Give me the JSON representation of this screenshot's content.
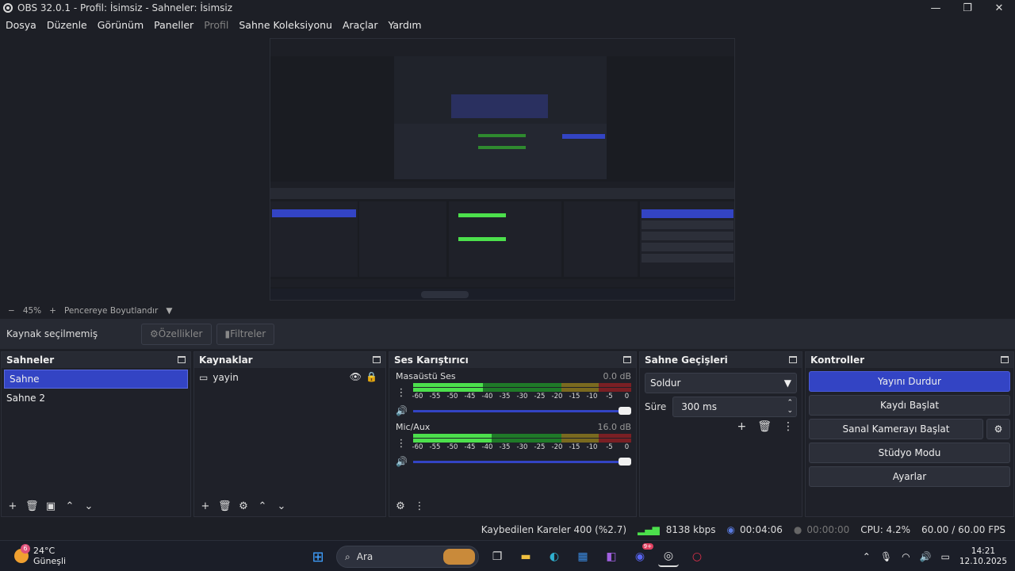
{
  "window": {
    "title": "OBS 32.0.1 - Profil: İsimsiz - Sahneler: İsimsiz"
  },
  "menu": [
    "Dosya",
    "Düzenle",
    "Görünüm",
    "Paneller",
    "Profil",
    "Sahne Koleksiyonu",
    "Araçlar",
    "Yardım"
  ],
  "zoom": {
    "minus": "−",
    "value": "45%",
    "plus": "+",
    "fit_label": "Pencereye Boyutlandır"
  },
  "toolbar": {
    "no_source": "Kaynak seçilmemiş",
    "properties": "Özellikler",
    "filters": "Filtreler"
  },
  "scenes": {
    "title": "Sahneler",
    "items": [
      "Sahne",
      "Sahne 2"
    ],
    "selected": 0
  },
  "sources": {
    "title": "Kaynaklar",
    "items": [
      "yayin"
    ]
  },
  "mixer": {
    "title": "Ses Karıştırıcı",
    "ticks": [
      "-60",
      "-55",
      "-50",
      "-45",
      "-40",
      "-35",
      "-30",
      "-25",
      "-20",
      "-15",
      "-10",
      "-5",
      "0"
    ],
    "channels": [
      {
        "name": "Masaüstü Ses",
        "db": "0.0 dB",
        "level": 0.32
      },
      {
        "name": "Mic/Aux",
        "db": "16.0 dB",
        "level": 0.36
      }
    ]
  },
  "transitions": {
    "title": "Sahne Geçişleri",
    "selected": "Soldur",
    "duration_label": "Süre",
    "duration_value": "300 ms"
  },
  "controls": {
    "title": "Kontroller",
    "buttons": [
      "Yayını Durdur",
      "Kaydı Başlat",
      "Sanal Kamerayı Başlat",
      "Stüdyo Modu",
      "Ayarlar"
    ]
  },
  "status": {
    "dropped": "Kaybedilen Kareler 400 (%2.7)",
    "bitrate": "8138 kbps",
    "stream_time": "00:04:06",
    "rec_time": "00:00:00",
    "cpu": "CPU: 4.2%",
    "fps": "60.00 / 60.00 FPS"
  },
  "taskbar": {
    "temp": "24°C",
    "weather": "Güneşli",
    "weather_badge": "6",
    "search": "Ara",
    "time": "14:21",
    "date": "12.10.2025",
    "discord_badge": "9+"
  },
  "colors": {
    "accent": "#3344c4",
    "meter_green": "#4ce04c",
    "bg": "#1d1f26"
  }
}
